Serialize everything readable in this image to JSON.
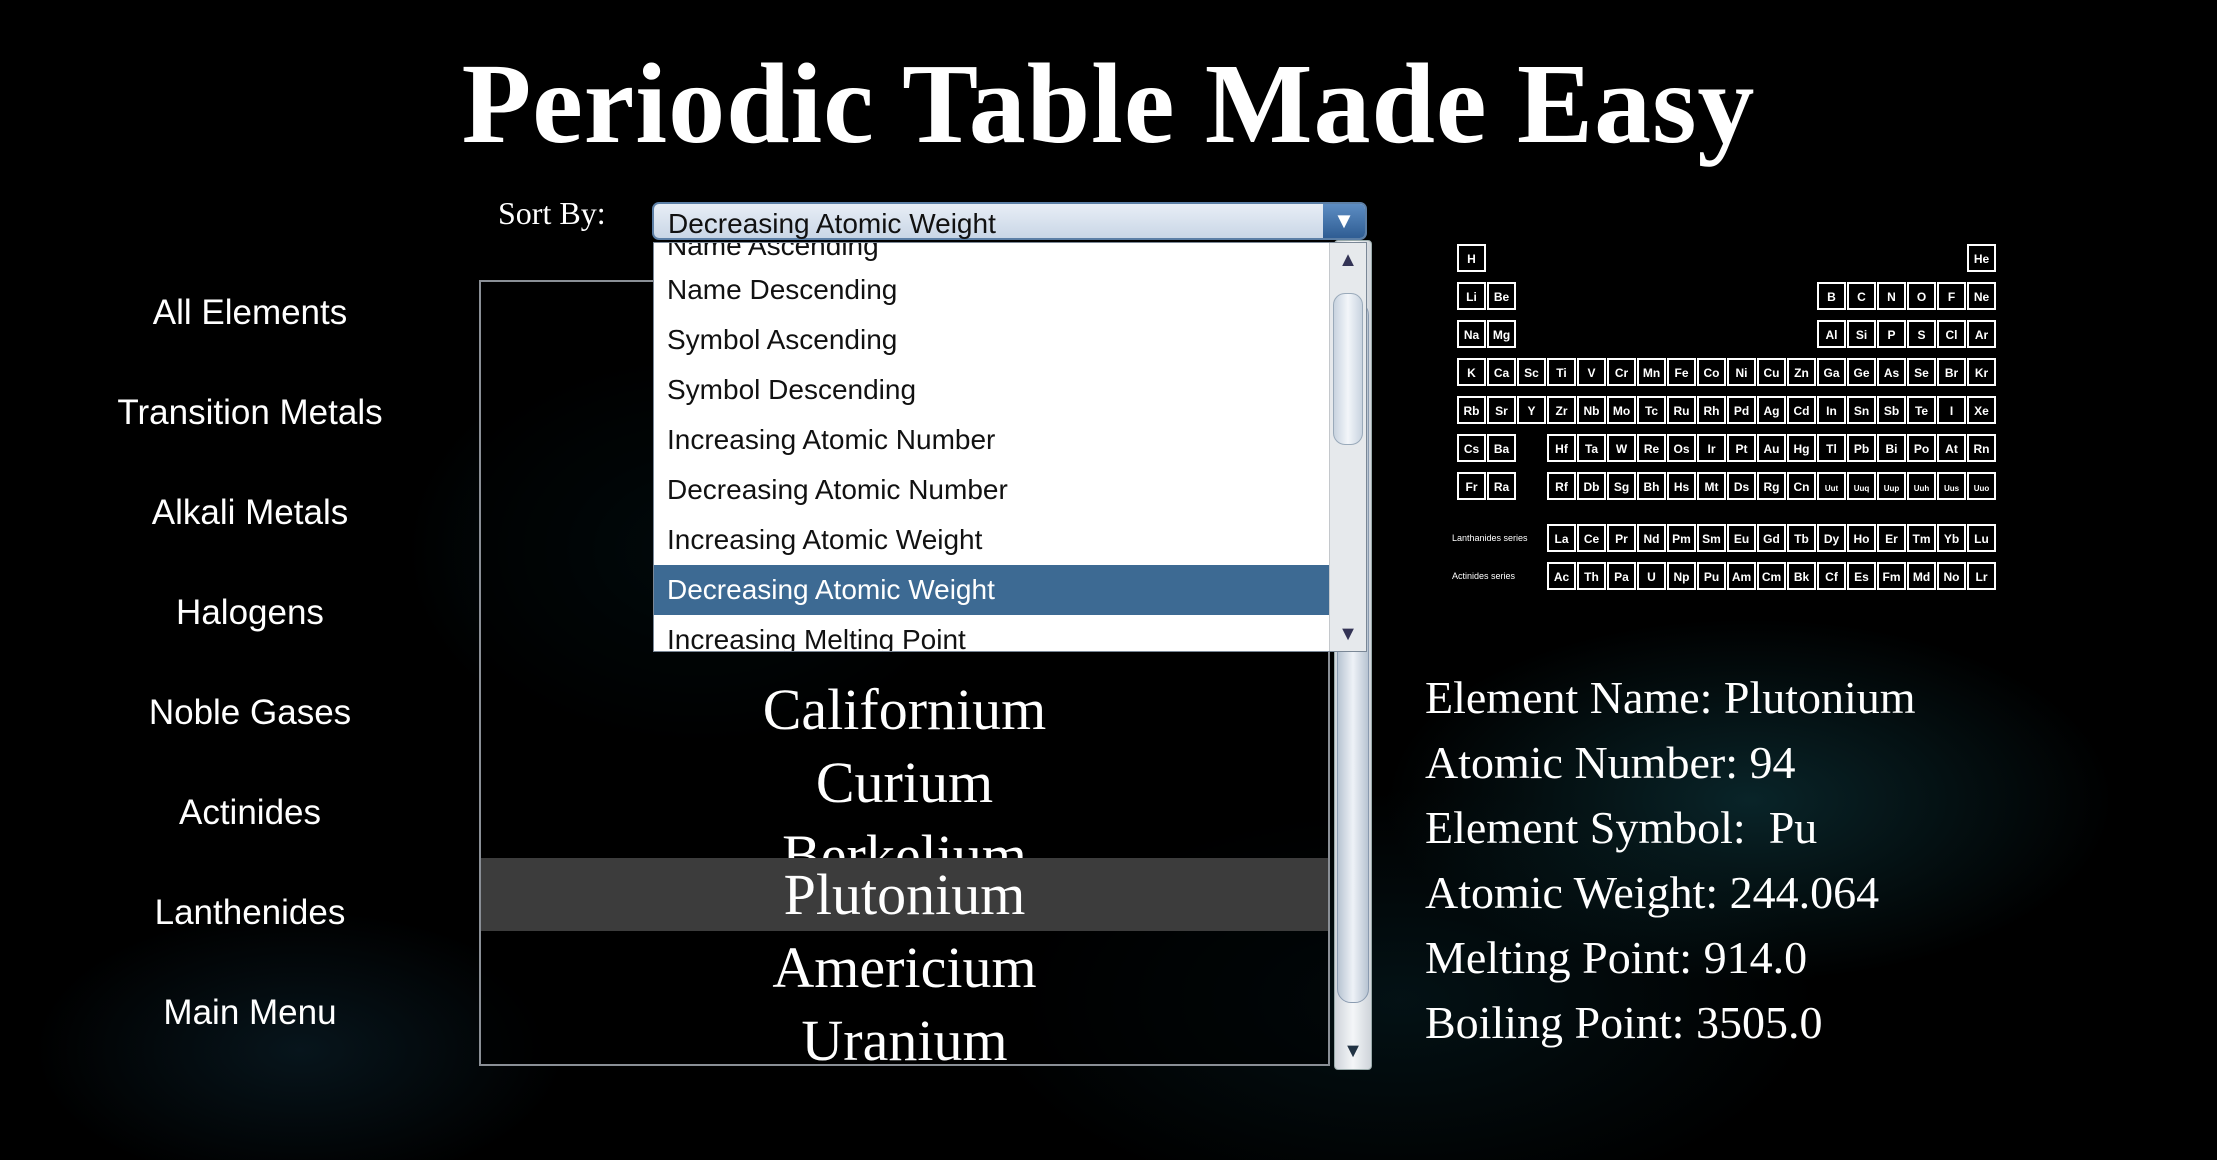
{
  "title": "Periodic Table Made Easy",
  "nav": [
    {
      "label": "All Elements"
    },
    {
      "label": "Transition Metals"
    },
    {
      "label": "Alkali Metals"
    },
    {
      "label": "Halogens"
    },
    {
      "label": "Noble Gases"
    },
    {
      "label": "Actinides"
    },
    {
      "label": "Lanthenides"
    },
    {
      "label": "Main Menu"
    }
  ],
  "sort": {
    "label": "Sort By:",
    "selected": "Decreasing Atomic Weight",
    "options": [
      "Name Ascending",
      "Name Descending",
      "Symbol Ascending",
      "Symbol Descending",
      "Increasing Atomic Number",
      "Decreasing Atomic Number",
      "Increasing Atomic Weight",
      "Decreasing Atomic Weight",
      "Increasing Melting Point"
    ]
  },
  "elements_list": {
    "items": [
      "Californium",
      "Curium",
      "Berkelium",
      "Plutonium",
      "Americium",
      "Uranium"
    ],
    "selected": "Plutonium"
  },
  "details": {
    "name": "Element Name: Plutonium",
    "atomic_number": "Atomic Number: 94",
    "symbol": "Element Symbol:  Pu",
    "atomic_weight": "Atomic Weight: 244.064",
    "melting_point": "Melting Point: 914.0",
    "boiling_point": "Boiling Point: 3505.0"
  },
  "periodic_table_image": {
    "rows": [
      [
        "H",
        "",
        "",
        "",
        "",
        "",
        "",
        "",
        "",
        "",
        "",
        "",
        "",
        "",
        "",
        "",
        "",
        "He"
      ],
      [
        "Li",
        "Be",
        "",
        "",
        "",
        "",
        "",
        "",
        "",
        "",
        "",
        "",
        "B",
        "C",
        "N",
        "O",
        "F",
        "Ne"
      ],
      [
        "Na",
        "Mg",
        "",
        "",
        "",
        "",
        "",
        "",
        "",
        "",
        "",
        "",
        "Al",
        "Si",
        "P",
        "S",
        "Cl",
        "Ar"
      ],
      [
        "K",
        "Ca",
        "Sc",
        "Ti",
        "V",
        "Cr",
        "Mn",
        "Fe",
        "Co",
        "Ni",
        "Cu",
        "Zn",
        "Ga",
        "Ge",
        "As",
        "Se",
        "Br",
        "Kr"
      ],
      [
        "Rb",
        "Sr",
        "Y",
        "Zr",
        "Nb",
        "Mo",
        "Tc",
        "Ru",
        "Rh",
        "Pd",
        "Ag",
        "Cd",
        "In",
        "Sn",
        "Sb",
        "Te",
        "I",
        "Xe"
      ],
      [
        "Cs",
        "Ba",
        "",
        "Hf",
        "Ta",
        "W",
        "Re",
        "Os",
        "Ir",
        "Pt",
        "Au",
        "Hg",
        "Tl",
        "Pb",
        "Bi",
        "Po",
        "At",
        "Rn"
      ],
      [
        "Fr",
        "Ra",
        "",
        "Rf",
        "Db",
        "Sg",
        "Bh",
        "Hs",
        "Mt",
        "Ds",
        "Rg",
        "Cn",
        "Uut",
        "Uuq",
        "Uup",
        "Uuh",
        "Uus",
        "Uuo"
      ]
    ],
    "lanthanides": [
      "La",
      "Ce",
      "Pr",
      "Nd",
      "Pm",
      "Sm",
      "Eu",
      "Gd",
      "Tb",
      "Dy",
      "Ho",
      "Er",
      "Tm",
      "Yb",
      "Lu"
    ],
    "actinides": [
      "Ac",
      "Th",
      "Pa",
      "U",
      "Np",
      "Pu",
      "Am",
      "Cm",
      "Bk",
      "Cf",
      "Es",
      "Fm",
      "Md",
      "No",
      "Lr"
    ],
    "lanthanides_label": "Lanthanides series",
    "actinides_label": "Actinides series"
  }
}
